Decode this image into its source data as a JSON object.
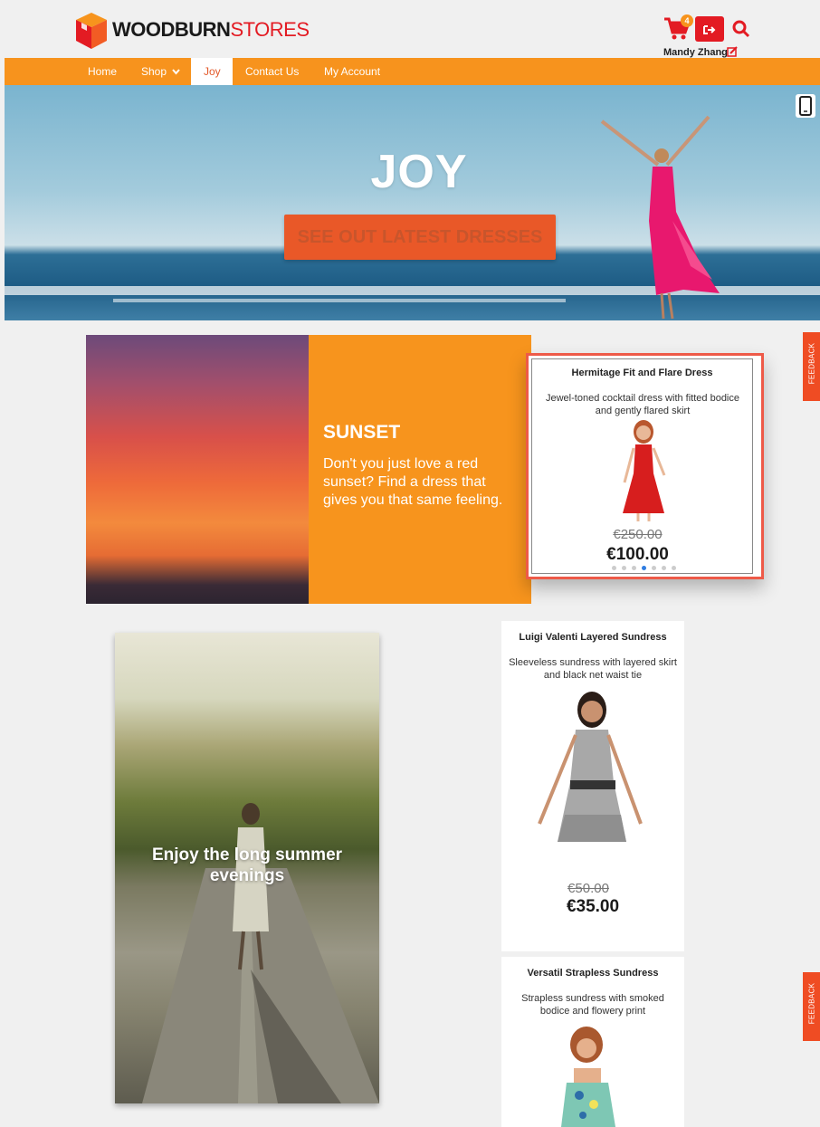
{
  "brand": {
    "name_bold": "WOODBURN",
    "name_light": "STORES"
  },
  "header": {
    "cart_count": "4",
    "user_name": "Mandy Zhang"
  },
  "nav": {
    "items": [
      "Home",
      "Shop",
      "Joy",
      "Contact Us",
      "My Account"
    ],
    "active": "Joy"
  },
  "hero": {
    "title": "JOY",
    "button_label": "SEE OUT LATEST DRESSES"
  },
  "sunset": {
    "heading": "SUNSET",
    "text": "Don't you just love a red sunset?  Find a dress that gives you that same feeling."
  },
  "products": [
    {
      "name": "Hermitage Fit and Flare Dress",
      "description": "Jewel-toned cocktail dress with fitted bodice and gently flared skirt",
      "old_price": "€250.00",
      "price": "€100.00",
      "carousel_active": 4,
      "carousel_total": 7
    },
    {
      "name": "Luigi Valenti Layered Sundress",
      "description": "Sleeveless sundress with layered skirt and black net waist tie",
      "old_price": "€50.00",
      "price": "€35.00"
    },
    {
      "name": "Versatil Strapless Sundress",
      "description": "Strapless sundress with smoked bodice and flowery print"
    }
  ],
  "summer": {
    "caption": "Enjoy the long summer evenings"
  },
  "feedback_label": "FEEDBACK",
  "colors": {
    "brand_orange": "#f7931d",
    "brand_red": "#e31b23",
    "hero_button": "#e95828",
    "card_border": "#ee5a48"
  }
}
